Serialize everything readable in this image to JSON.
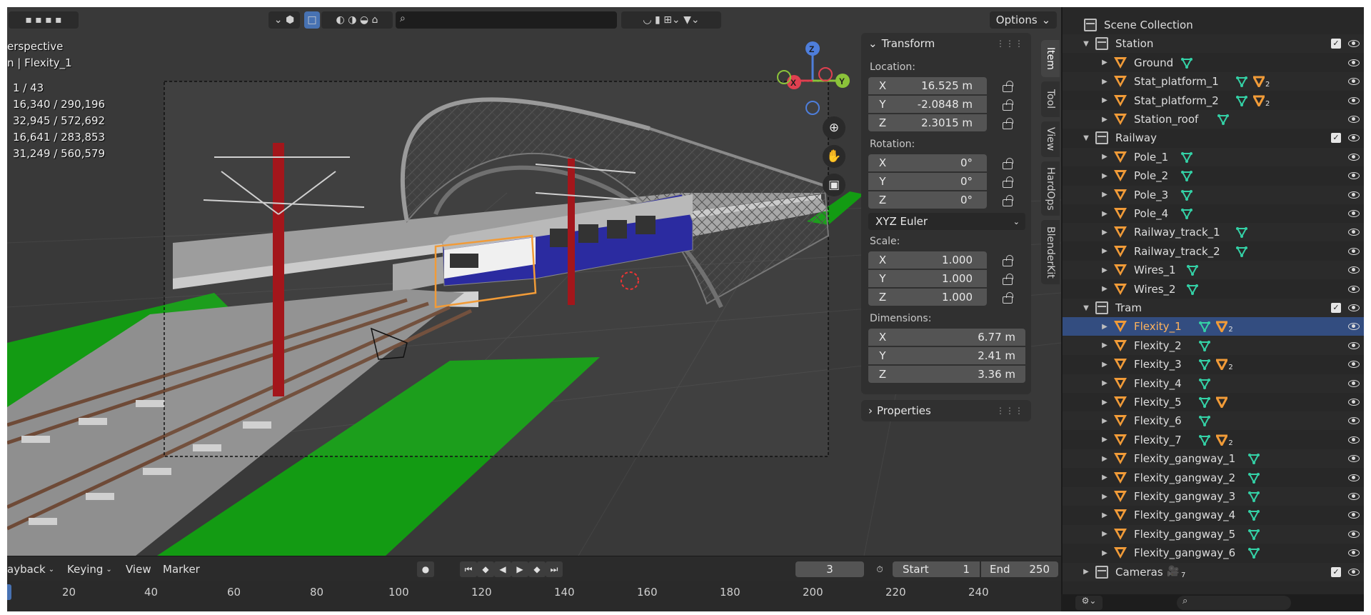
{
  "viewport": {
    "mode_label": "erspective",
    "object_label": "n | Flexity_1",
    "stats": [
      "1 / 43",
      "16,340 / 290,196",
      "32,945 / 572,692",
      "16,641 / 283,853",
      "31,249 / 560,579"
    ],
    "options_label": "Options",
    "gizmo": {
      "z": "Z",
      "x": "X",
      "y": "Y"
    }
  },
  "npanel": {
    "transform_title": "Transform",
    "location_label": "Location:",
    "location": [
      {
        "axis": "X",
        "value": "16.525 m"
      },
      {
        "axis": "Y",
        "value": "-2.0848 m"
      },
      {
        "axis": "Z",
        "value": "2.3015 m"
      }
    ],
    "rotation_label": "Rotation:",
    "rotation": [
      {
        "axis": "X",
        "value": "0°"
      },
      {
        "axis": "Y",
        "value": "0°"
      },
      {
        "axis": "Z",
        "value": "0°"
      }
    ],
    "rotation_mode": "XYZ Euler",
    "scale_label": "Scale:",
    "scale": [
      {
        "axis": "X",
        "value": "1.000"
      },
      {
        "axis": "Y",
        "value": "1.000"
      },
      {
        "axis": "Z",
        "value": "1.000"
      }
    ],
    "dimensions_label": "Dimensions:",
    "dimensions": [
      {
        "axis": "X",
        "value": "6.77 m"
      },
      {
        "axis": "Y",
        "value": "2.41 m"
      },
      {
        "axis": "Z",
        "value": "3.36 m"
      }
    ],
    "properties_title": "Properties"
  },
  "side_tabs": [
    "Item",
    "Tool",
    "View",
    "HardOps",
    "BlenderKit"
  ],
  "outliner": {
    "rows": [
      {
        "label": "Scene Collection",
        "kind": "scene",
        "level": 0
      },
      {
        "label": "Station",
        "kind": "collection",
        "level": 1
      },
      {
        "label": "Ground",
        "kind": "object",
        "level": 2
      },
      {
        "label": "Stat_platform_1",
        "kind": "object",
        "level": 2,
        "mods": "2"
      },
      {
        "label": "Stat_platform_2",
        "kind": "object",
        "level": 2,
        "mods": "2"
      },
      {
        "label": "Station_roof",
        "kind": "object",
        "level": 2
      },
      {
        "label": "Railway",
        "kind": "collection",
        "level": 1
      },
      {
        "label": "Pole_1",
        "kind": "object",
        "level": 2
      },
      {
        "label": "Pole_2",
        "kind": "object",
        "level": 2
      },
      {
        "label": "Pole_3",
        "kind": "object",
        "level": 2
      },
      {
        "label": "Pole_4",
        "kind": "object",
        "level": 2
      },
      {
        "label": "Railway_track_1",
        "kind": "object",
        "level": 2
      },
      {
        "label": "Railway_track_2",
        "kind": "object",
        "level": 2
      },
      {
        "label": "Wires_1",
        "kind": "object",
        "level": 2
      },
      {
        "label": "Wires_2",
        "kind": "object",
        "level": 2
      },
      {
        "label": "Tram",
        "kind": "collection",
        "level": 1
      },
      {
        "label": "Flexity_1",
        "kind": "object",
        "level": 2,
        "mods": "2",
        "selected": true
      },
      {
        "label": "Flexity_2",
        "kind": "object",
        "level": 2
      },
      {
        "label": "Flexity_3",
        "kind": "object",
        "level": 2,
        "mods": "2"
      },
      {
        "label": "Flexity_4",
        "kind": "object",
        "level": 2
      },
      {
        "label": "Flexity_5",
        "kind": "object",
        "level": 2,
        "mods": ""
      },
      {
        "label": "Flexity_6",
        "kind": "object",
        "level": 2
      },
      {
        "label": "Flexity_7",
        "kind": "object",
        "level": 2,
        "mods": "2"
      },
      {
        "label": "Flexity_gangway_1",
        "kind": "object",
        "level": 2
      },
      {
        "label": "Flexity_gangway_2",
        "kind": "object",
        "level": 2
      },
      {
        "label": "Flexity_gangway_3",
        "kind": "object",
        "level": 2
      },
      {
        "label": "Flexity_gangway_4",
        "kind": "object",
        "level": 2
      },
      {
        "label": "Flexity_gangway_5",
        "kind": "object",
        "level": 2
      },
      {
        "label": "Flexity_gangway_6",
        "kind": "object",
        "level": 2
      },
      {
        "label": "Cameras",
        "kind": "collection",
        "level": 1,
        "cams": "7"
      }
    ]
  },
  "timeline": {
    "playback": "ayback",
    "keying": "Keying",
    "view": "View",
    "marker": "Marker",
    "current_frame": "3",
    "start_label": "Start",
    "start": "1",
    "end_label": "End",
    "end": "250",
    "ticks": [
      "20",
      "40",
      "60",
      "80",
      "100",
      "120",
      "140",
      "160",
      "180",
      "200",
      "220",
      "240"
    ]
  },
  "colors": {
    "accent": "#4772b3",
    "selection": "#f19b38",
    "mesh": "#34d1a6",
    "ground": "#129a12",
    "pole": "#a3161b",
    "tram_blue": "#14149a"
  }
}
